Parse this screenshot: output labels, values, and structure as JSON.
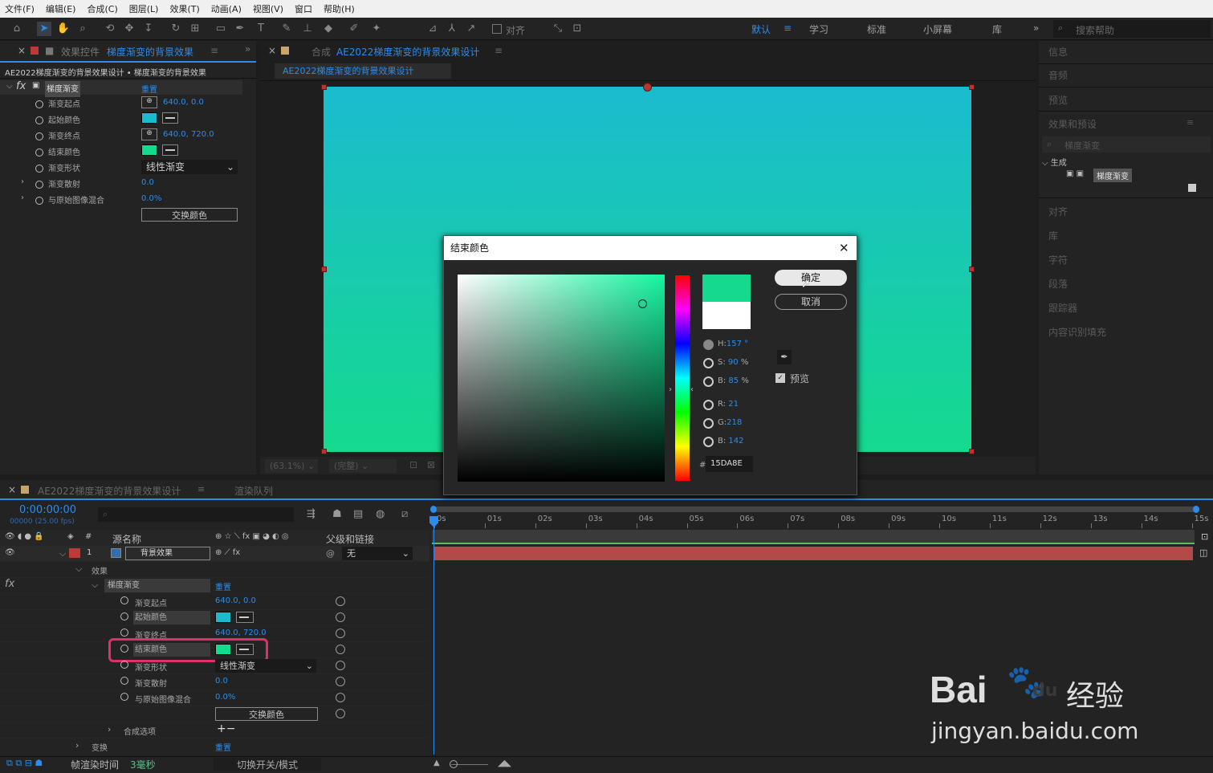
{
  "menu": [
    "文件(F)",
    "编辑(E)",
    "合成(C)",
    "图层(L)",
    "效果(T)",
    "动画(A)",
    "视图(V)",
    "窗口",
    "帮助(H)"
  ],
  "toolbar": {
    "align_label": "对齐",
    "workspaces": [
      "默认",
      "学习",
      "标准",
      "小屏幕",
      "库"
    ],
    "search_placeholder": "搜索帮助"
  },
  "effect_panel": {
    "tab_prefix": "效果控件",
    "tab_name": "梯度渐变的背景效果",
    "breadcrumb": "AE2022梯度渐变的背景效果设计 • 梯度渐变的背景效果",
    "effect_name": "梯度渐变",
    "reset": "重置",
    "props": [
      {
        "label": "渐变起点",
        "value": "640.0, 0.0"
      },
      {
        "label": "起始颜色",
        "value": ""
      },
      {
        "label": "渐变终点",
        "value": "640.0, 720.0"
      },
      {
        "label": "结束颜色",
        "value": ""
      },
      {
        "label": "渐变形状",
        "value": "线性渐变"
      },
      {
        "label": "渐变散射",
        "value": "0.0"
      },
      {
        "label": "与原始图像混合",
        "value": "0.0%"
      }
    ],
    "swap_button": "交换颜色"
  },
  "comp_panel": {
    "tab_prefix": "合成",
    "tab_name": "AE2022梯度渐变的背景效果设计",
    "sub_tab": "AE2022梯度渐变的背景效果设计",
    "zoom": "(63.1%)",
    "quality": "(完整)"
  },
  "colors": {
    "start": "#1BBBCF",
    "end": "#15DA8E",
    "accent": "#2d8ceb",
    "highlight": "#e0306a"
  },
  "dialog": {
    "title": "结束颜色",
    "ok": "确定",
    "cancel": "取消",
    "preview_label": "预览",
    "H": "157",
    "H_unit": "°",
    "S": "90",
    "S_unit": "%",
    "B": "85",
    "B_unit": "%",
    "R": "21",
    "G": "218",
    "Bl": "142",
    "hex": "15DA8E",
    "labels": {
      "H": "H:",
      "S": "S:",
      "B": "B:",
      "R": "R:",
      "G": "G:",
      "Bl": "B:",
      "hash": "#"
    }
  },
  "right_panel": {
    "items": [
      "信息",
      "音频",
      "预览",
      "效果和预设",
      "对齐",
      "库",
      "字符",
      "段落",
      "跟踪器",
      "内容识别填充"
    ],
    "search_value": "梯度渐变",
    "tree_group": "生成",
    "tree_item": "梯度渐变"
  },
  "timeline": {
    "tab_name": "AE2022梯度渐变的背景效果设计",
    "render_tab": "渲染队列",
    "timecode": "0:00:00:00",
    "frames": "00000 (25.00 fps)",
    "col_source": "源名称",
    "col_parent": "父级和链接",
    "layer_num": "1",
    "layer_name": "背景效果",
    "parent_value": "无",
    "effects": "效果",
    "effect": "梯度渐变",
    "reset": "重置",
    "props": [
      "渐变起点",
      "起始颜色",
      "渐变终点",
      "结束颜色",
      "渐变形状",
      "渐变散射",
      "与原始图像混合"
    ],
    "prop_values": [
      "640.0, 0.0",
      "",
      "640.0, 720.0",
      "",
      "线性渐变",
      "0.0",
      "0.0%"
    ],
    "swap": "交换颜色",
    "comp_options": "合成选项",
    "transform": "变换",
    "transform_reset": "重置",
    "ticks": [
      "0s",
      "01s",
      "02s",
      "03s",
      "04s",
      "05s",
      "06s",
      "07s",
      "08s",
      "09s",
      "10s",
      "11s",
      "12s",
      "13s",
      "14s",
      "15s"
    ],
    "footer_label": "帧渲染时间",
    "footer_value": "3毫秒",
    "toggle": "切换开关/模式"
  },
  "watermark": {
    "brand": "Bai",
    "du": "du",
    "cn": "经验",
    "url": "jingyan.baidu.com"
  }
}
